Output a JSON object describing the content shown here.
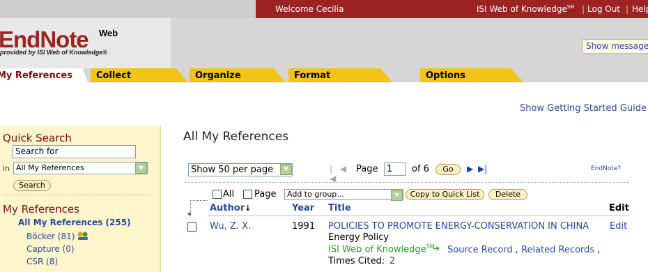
{
  "topbar": {
    "welcome": "Welcome Cecilia",
    "isi_link": "ISI Web of Knowledge",
    "isi_sup": "SM",
    "separator": "|",
    "logout": "Log Out",
    "help": "Help"
  },
  "logo": {
    "main": "EndNote",
    "web": "Web",
    "subtitle": "provided by ISI Web of Knowledge®"
  },
  "show_message": "Show message",
  "tabs": [
    {
      "label": "My References",
      "active": true
    },
    {
      "label": "Collect",
      "active": false
    },
    {
      "label": "Organize",
      "active": false
    },
    {
      "label": "Format",
      "active": false
    },
    {
      "label": "Options",
      "active": false
    }
  ],
  "getting_started": "Show Getting Started Guide",
  "sidebar": {
    "quick_search_title": "Quick Search",
    "search_value": "Search for",
    "in_label": "in",
    "scope_selected": "All My References",
    "search_button": "Search",
    "my_references_title": "My References",
    "groups": [
      {
        "label": "All My References (255)"
      },
      {
        "label": "Böcker (81)"
      },
      {
        "label": "Capture (0)"
      },
      {
        "label": "CSR (8)"
      }
    ]
  },
  "main": {
    "title": "All My References",
    "per_page": "Show 50 per page",
    "page_label": "Page",
    "page_value": "1",
    "of_pages": "of 6",
    "go_button": "Go",
    "endnote_help": "EndNote?",
    "all_label": "All",
    "page_check_label": "Page",
    "add_to_group": "Add to group...",
    "copy_button": "Copy to Quick List",
    "delete_button": "Delete",
    "columns": {
      "author": "Author",
      "year": "Year",
      "title": "Title",
      "edit": "Edit"
    },
    "rows": [
      {
        "author": "Wu, Z. X.",
        "year": "1991",
        "title": "POLICIES TO PROMOTE ENERGY-CONSERVATION IN CHINA",
        "journal": "Energy Policy",
        "isi": "ISI Web of Knowledge",
        "isi_sup": "SM",
        "source_record": "Source Record",
        "related_records": "Related Records",
        "times_cited_label": "Times Cited:",
        "times_cited": "2",
        "edit": "Edit"
      }
    ]
  },
  "colors": {
    "brand_red": "#9b2423",
    "tab_yellow": "#f2c318",
    "link_blue": "#2a4a9a",
    "sidebar_bg": "#fdf6cc",
    "isi_green": "#2f9a2f"
  }
}
